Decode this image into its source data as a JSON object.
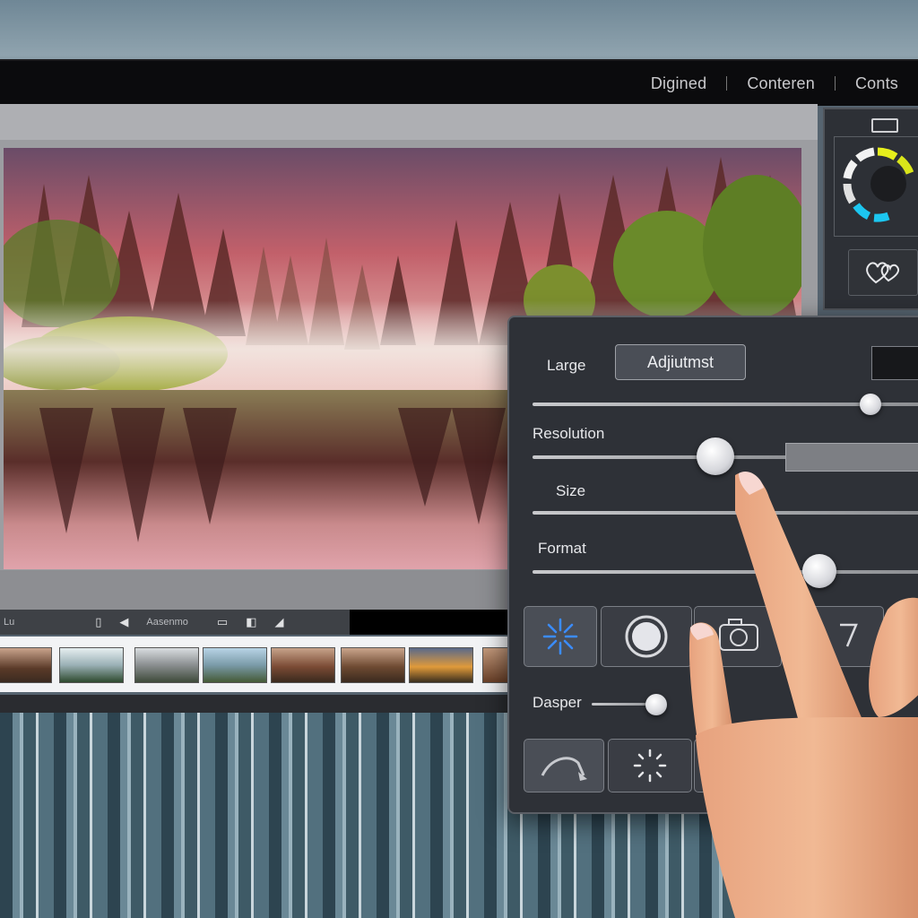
{
  "nav": {
    "items": [
      {
        "label": "Digined"
      },
      {
        "label": "Conteren"
      },
      {
        "label": "Conts"
      }
    ]
  },
  "toolbar": {
    "left_label": "Lu",
    "mid_label": "Aasenmo"
  },
  "panel": {
    "large_label": "Large",
    "adjust_button": "Adjiutmst",
    "resolution_label": "Resolution",
    "size_label": "Size",
    "format_label": "Format",
    "dasper_label": "Dasper",
    "sliders": {
      "large": 0.85,
      "resolution": 0.46,
      "format": 0.72,
      "dasper": 0.9
    }
  },
  "icons": {
    "mini_panel": [
      "tab-icon",
      "color-wheel-icon",
      "hearts-icon"
    ],
    "tool_row_1": [
      "sparkle-icon",
      "circle-icon",
      "camera-icon",
      "triangle-icon"
    ],
    "tool_row_2": [
      "curve-icon",
      "dotted-circle-icon"
    ]
  },
  "colors": {
    "panel_bg": "#2e3137",
    "accent_blue": "#3b8cff",
    "wheel_yellow": "#e6ef1c",
    "wheel_cyan": "#1cc6f0"
  }
}
